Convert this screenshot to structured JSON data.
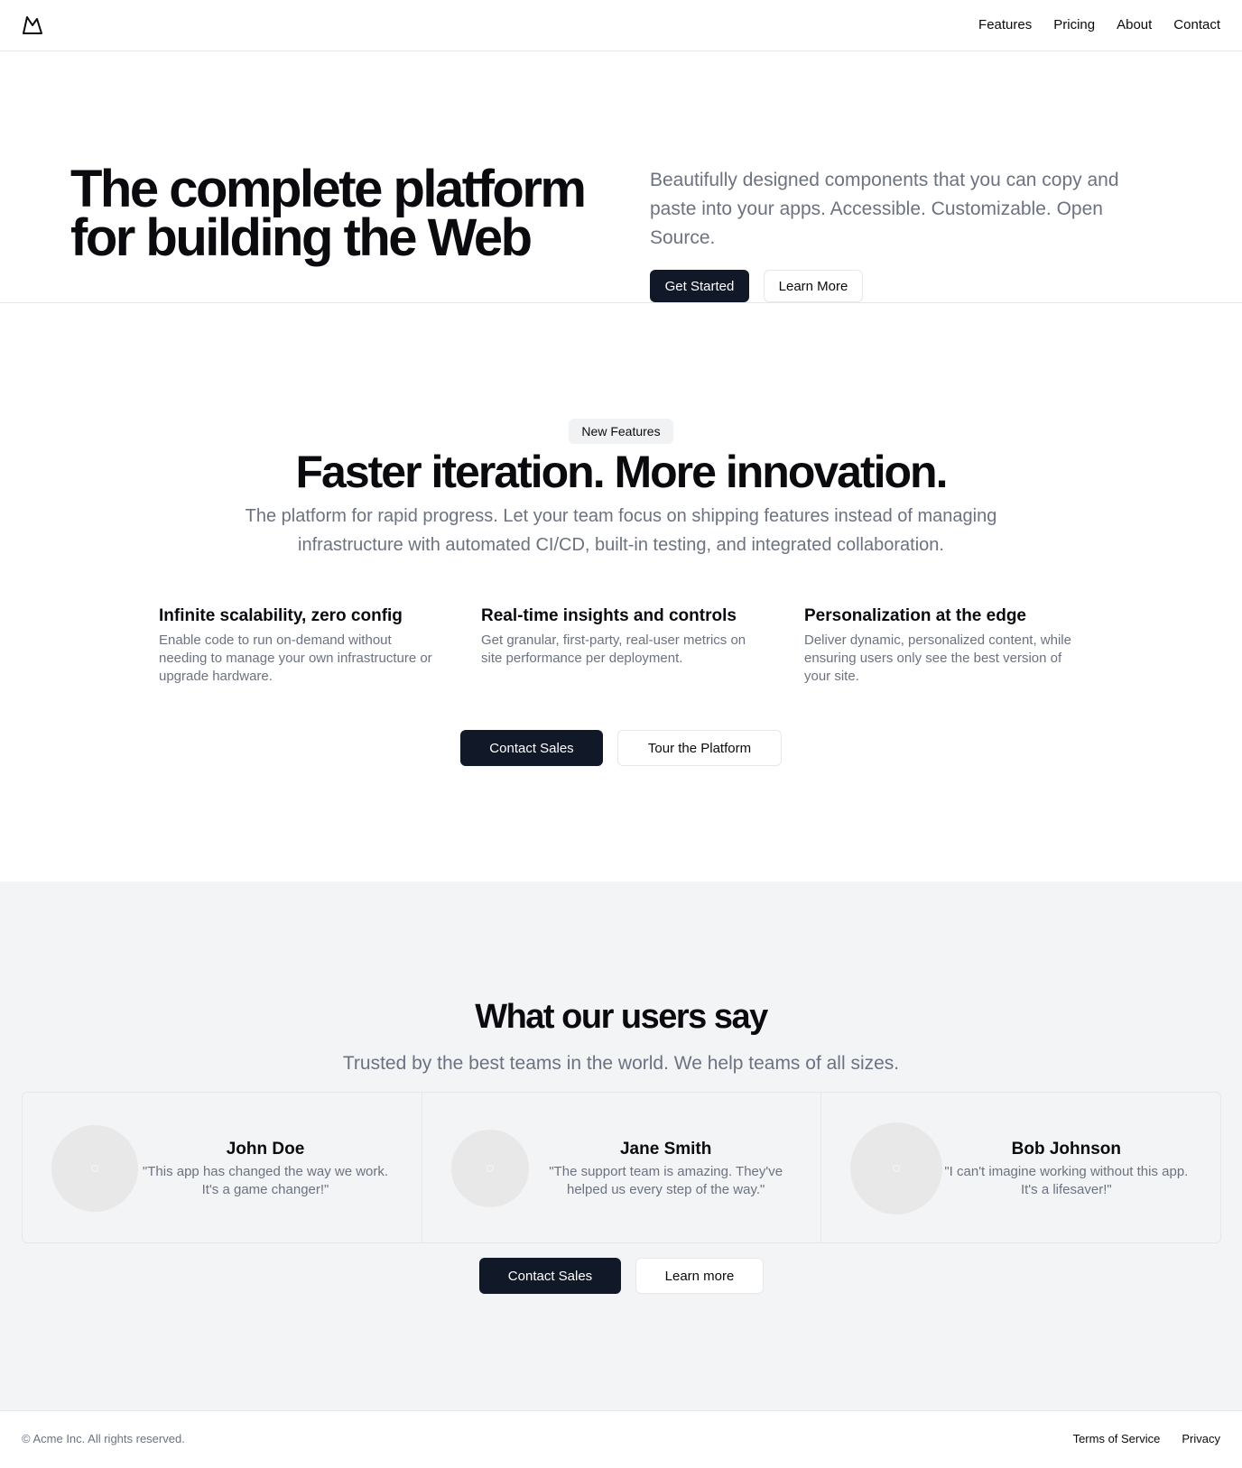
{
  "header": {
    "logo_icon": "mountain-logo-icon",
    "nav": [
      "Features",
      "Pricing",
      "About",
      "Contact"
    ]
  },
  "hero": {
    "title": "The complete platform for building the Web",
    "description": "Beautifully designed components that you can copy and paste into your apps. Accessible. Customizable. Open Source.",
    "primary_button": "Get Started",
    "secondary_button": "Learn More"
  },
  "features_section": {
    "badge": "New Features",
    "title": "Faster iteration. More innovation.",
    "subtitle": "The platform for rapid progress. Let your team focus on shipping features instead of managing infrastructure with automated CI/CD, built-in testing, and integrated collaboration.",
    "features": [
      {
        "title": "Infinite scalability, zero config",
        "description": "Enable code to run on-demand without needing to manage your own infrastructure or upgrade hardware."
      },
      {
        "title": "Real-time insights and controls",
        "description": "Get granular, first-party, real-user metrics on site performance per deployment."
      },
      {
        "title": "Personalization at the edge",
        "description": "Deliver dynamic, personalized content, while ensuring users only see the best version of your site."
      }
    ],
    "primary_button": "Contact Sales",
    "secondary_button": "Tour the Platform"
  },
  "testimonials": {
    "title": "What our users say",
    "subtitle": "Trusted by the best teams in the world. We help teams of all sizes.",
    "items": [
      {
        "name": "John Doe",
        "quote": "\"This app has changed the way we work. It's a game changer!\""
      },
      {
        "name": "Jane Smith",
        "quote": "\"The support team is amazing. They've helped us every step of the way.\""
      },
      {
        "name": "Bob Johnson",
        "quote": "\"I can't imagine working without this app. It's a lifesaver!\""
      }
    ],
    "primary_button": "Contact Sales",
    "secondary_button": "Learn more"
  },
  "footer": {
    "copyright": "© Acme Inc. All rights reserved.",
    "links": [
      "Terms of Service",
      "Privacy"
    ]
  },
  "colors": {
    "primary_dark": "#111827",
    "muted_text": "#6b7280",
    "section_bg": "#f3f4f6",
    "border": "#e5e7eb"
  }
}
